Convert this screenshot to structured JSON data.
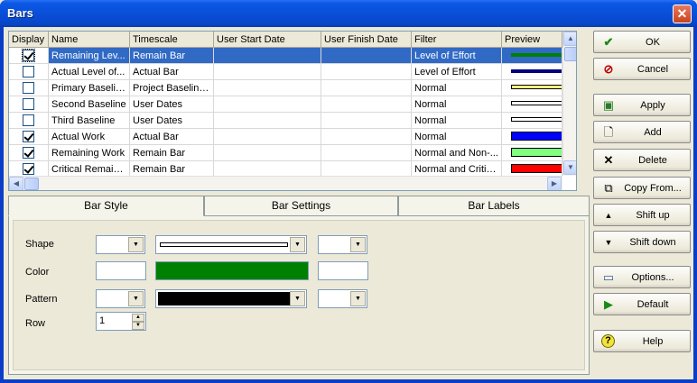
{
  "window": {
    "title": "Bars",
    "close_glyph": "✕"
  },
  "grid": {
    "columns": [
      "Display",
      "Name",
      "Timescale",
      "User Start Date",
      "User Finish Date",
      "Filter",
      "Preview"
    ],
    "rows": [
      {
        "display": true,
        "name": "Remaining Lev...",
        "timescale": "Remain Bar",
        "user_start": "",
        "user_finish": "",
        "filter": "Level of Effort",
        "preview_color": "#008000",
        "preview_style": "solid-thick"
      },
      {
        "display": false,
        "name": "Actual Level of...",
        "timescale": "Actual Bar",
        "user_start": "",
        "user_finish": "",
        "filter": "Level of Effort",
        "preview_color": "#000080",
        "preview_style": "solid-thick"
      },
      {
        "display": false,
        "name": "Primary Baseline",
        "timescale": "Project Baseline...",
        "user_start": "",
        "user_finish": "",
        "filter": "Normal",
        "preview_color": "#ffff80",
        "preview_style": "outline"
      },
      {
        "display": false,
        "name": "Second Baseline",
        "timescale": "User Dates",
        "user_start": "",
        "user_finish": "",
        "filter": "Normal",
        "preview_color": "#ffffff",
        "preview_style": "outline"
      },
      {
        "display": false,
        "name": "Third Baseline",
        "timescale": "User Dates",
        "user_start": "",
        "user_finish": "",
        "filter": "Normal",
        "preview_color": "#ffffff",
        "preview_style": "outline"
      },
      {
        "display": true,
        "name": "Actual Work",
        "timescale": "Actual Bar",
        "user_start": "",
        "user_finish": "",
        "filter": "Normal",
        "preview_color": "#0000ff",
        "preview_style": "block"
      },
      {
        "display": true,
        "name": "Remaining Work",
        "timescale": "Remain Bar",
        "user_start": "",
        "user_finish": "",
        "filter": "Normal and Non-...",
        "preview_color": "#80ff80",
        "preview_style": "block"
      },
      {
        "display": true,
        "name": "Critical Remaini...",
        "timescale": "Remain Bar",
        "user_start": "",
        "user_finish": "",
        "filter": "Normal and Critical",
        "preview_color": "#ff0000",
        "preview_style": "block"
      }
    ]
  },
  "tabs": [
    "Bar Style",
    "Bar Settings",
    "Bar Labels"
  ],
  "bar_style": {
    "shape_label": "Shape",
    "color_label": "Color",
    "pattern_label": "Pattern",
    "row_label": "Row",
    "middle_color": "#008000",
    "pattern_color": "#000000",
    "row_value": "1"
  },
  "buttons": [
    {
      "label": "OK",
      "icon": "check-icon"
    },
    {
      "label": "Cancel",
      "icon": "cancel-icon"
    },
    {
      "label": "Apply",
      "icon": "apply-icon"
    },
    {
      "label": "Add",
      "icon": "add-icon"
    },
    {
      "label": "Delete",
      "icon": "delete-icon"
    },
    {
      "label": "Copy From...",
      "icon": "copy-icon"
    },
    {
      "label": "Shift up",
      "icon": "shift-up-icon"
    },
    {
      "label": "Shift down",
      "icon": "shift-down-icon"
    },
    {
      "label": "Options...",
      "icon": "options-icon"
    },
    {
      "label": "Default",
      "icon": "default-icon"
    },
    {
      "label": "Help",
      "icon": "help-icon"
    }
  ]
}
